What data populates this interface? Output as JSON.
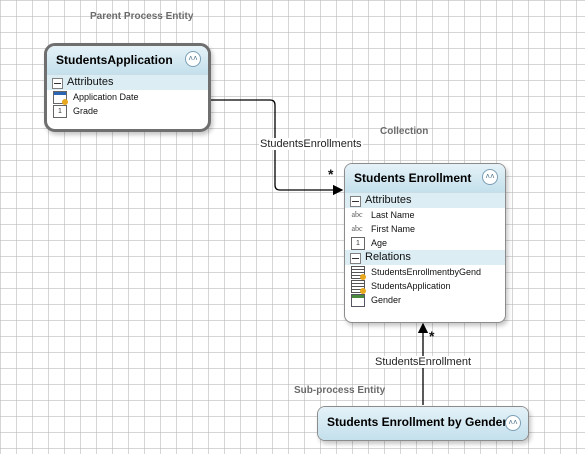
{
  "captions": {
    "parent": "Parent Process Entity",
    "collection": "Collection",
    "subprocess": "Sub-process Entity"
  },
  "entities": {
    "students_application": {
      "title": "StudentsApplication",
      "attributes_label": "Attributes",
      "attributes": [
        {
          "icon": "calendar-icon",
          "label": "Application Date"
        },
        {
          "icon": "number-icon",
          "label": "Grade",
          "glyph": "1"
        }
      ]
    },
    "students_enrollment": {
      "title": "Students Enrollment",
      "attributes_label": "Attributes",
      "attributes": [
        {
          "icon": "text-icon",
          "label": "Last Name",
          "glyph": "abc"
        },
        {
          "icon": "text-icon",
          "label": "First Name",
          "glyph": "abc"
        },
        {
          "icon": "number-icon",
          "label": "Age",
          "glyph": "1"
        }
      ],
      "relations_label": "Relations",
      "relations": [
        {
          "icon": "relation-icon",
          "label": "StudentsEnrollmentbyGend"
        },
        {
          "icon": "relation-icon",
          "label": "StudentsApplication"
        },
        {
          "icon": "table-icon",
          "label": "Gender"
        }
      ]
    },
    "students_enrollment_by_gender": {
      "title": "Students Enrollment by Gender"
    }
  },
  "connectors": {
    "top": {
      "label": "StudentsEnrollments",
      "multiplicity": "*"
    },
    "bottom": {
      "label": "StudentsEnrollment",
      "multiplicity": "*"
    }
  },
  "colors": {
    "header_gradient_top": "#e5f2f8",
    "header_gradient_bottom": "#c4e0ec",
    "section_band": "#dcedf3"
  }
}
